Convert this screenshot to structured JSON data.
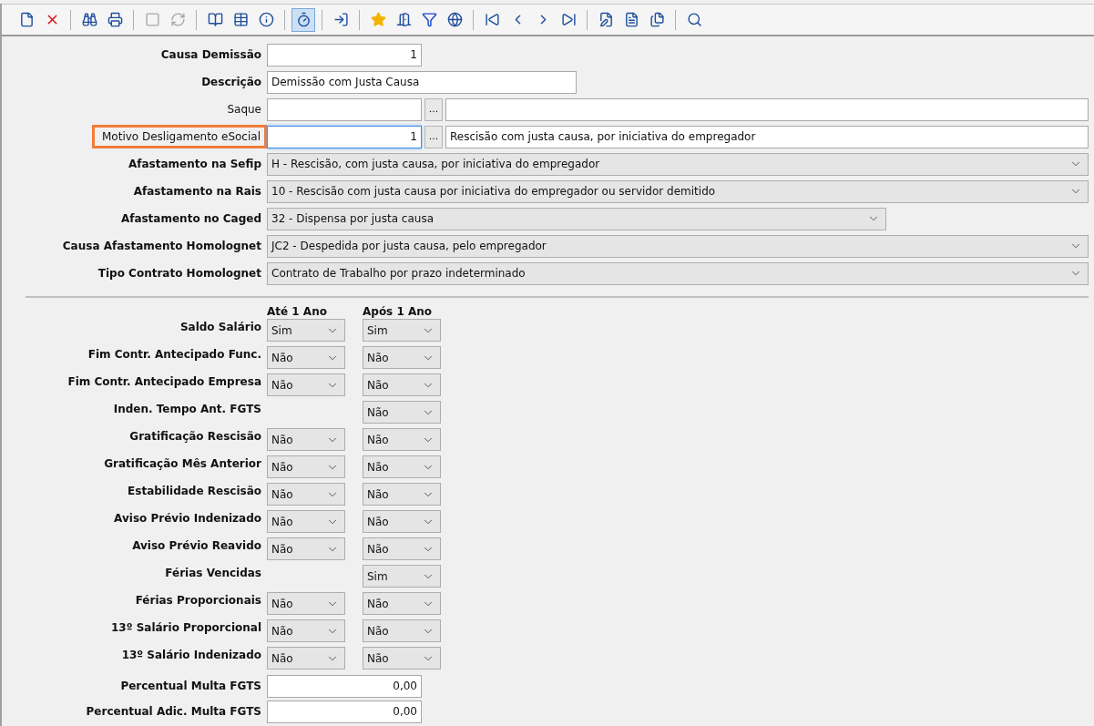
{
  "toolbar": {
    "groups": [
      [
        {
          "pressed": false,
          "disabled": false
        },
        {
          "pressed": false,
          "disabled": false
        }
      ],
      [
        {
          "pressed": false,
          "disabled": false
        },
        {
          "pressed": false,
          "disabled": false
        }
      ],
      [
        {
          "pressed": false,
          "disabled": true
        },
        {
          "pressed": false,
          "disabled": true
        }
      ],
      [
        {
          "pressed": false,
          "disabled": false
        },
        {
          "pressed": false,
          "disabled": false
        },
        {
          "pressed": false,
          "disabled": false
        }
      ],
      [
        {
          "pressed": true,
          "disabled": false
        }
      ],
      [
        {
          "pressed": false,
          "disabled": false
        }
      ],
      [
        {
          "pressed": false,
          "disabled": false
        },
        {
          "pressed": false,
          "disabled": false
        },
        {
          "pressed": false,
          "disabled": false
        },
        {
          "pressed": false,
          "disabled": false
        }
      ],
      [
        {
          "pressed": false,
          "disabled": false
        },
        {
          "pressed": false,
          "disabled": false
        },
        {
          "pressed": false,
          "disabled": false
        },
        {
          "pressed": false,
          "disabled": false
        }
      ],
      [
        {
          "pressed": false,
          "disabled": false
        },
        {
          "pressed": false,
          "disabled": false
        },
        {
          "pressed": false,
          "disabled": false
        }
      ],
      [
        {
          "pressed": false,
          "disabled": false
        }
      ]
    ]
  },
  "fields": [
    {
      "kind": "number",
      "label": "Causa Demissão",
      "bold": true,
      "value": "1"
    },
    {
      "kind": "text",
      "label": "Descrição",
      "bold": true,
      "value": "Demissão com Justa Causa"
    },
    {
      "kind": "lookup",
      "label": "Saque",
      "bold": false,
      "highlighted": false,
      "focused": false,
      "button": "..."
    },
    {
      "kind": "lookup",
      "label": "Motivo Desligamento eSocial",
      "bold": false,
      "highlighted": true,
      "focused": true,
      "value": "1",
      "button": "...",
      "description": "Rescisão com justa causa, por iniciativa do empregador"
    },
    {
      "kind": "select",
      "label": "Afastamento na Sefip",
      "bold": true,
      "wide": true,
      "value": "H - Rescisão, com justa causa, por iniciativa do empregador"
    },
    {
      "kind": "select",
      "label": "Afastamento na Rais",
      "bold": true,
      "wide": true,
      "value": "10 - Rescisão com justa causa por iniciativa do empregador ou servidor demitido"
    },
    {
      "kind": "select",
      "label": "Afastamento no Caged",
      "bold": true,
      "wide": false,
      "value": "32 - Dispensa por justa causa"
    },
    {
      "kind": "select",
      "label": "Causa Afastamento Homolognet",
      "bold": true,
      "wide": true,
      "value": "JC2 - Despedida por justa causa, pelo empregador"
    },
    {
      "kind": "select",
      "label": "Tipo Contrato Homolognet",
      "bold": true,
      "wide": true,
      "value": "Contrato de Trabalho por prazo indeterminado"
    }
  ],
  "rescission": {
    "columns": [
      "Até 1 Ano",
      "Após 1 Ano"
    ],
    "rows": [
      {
        "label": "Saldo Salário",
        "until_1_year": "Sim",
        "after_1_year": "Sim"
      },
      {
        "label": "Fim Contr. Antecipado Func.",
        "until_1_year": "Não",
        "after_1_year": "Não"
      },
      {
        "label": "Fim Contr. Antecipado Empresa",
        "until_1_year": "Não",
        "after_1_year": "Não"
      },
      {
        "label": "Inden. Tempo Ant. FGTS",
        "after_1_year": "Não"
      },
      {
        "label": "Gratificação Rescisão",
        "until_1_year": "Não",
        "after_1_year": "Não"
      },
      {
        "label": "Gratificação Mês Anterior",
        "until_1_year": "Não",
        "after_1_year": "Não"
      },
      {
        "label": "Estabilidade Rescisão",
        "until_1_year": "Não",
        "after_1_year": "Não"
      },
      {
        "label": "Aviso Prévio Indenizado",
        "until_1_year": "Não",
        "after_1_year": "Não"
      },
      {
        "label": "Aviso Prévio Reavido",
        "until_1_year": "Não",
        "after_1_year": "Não"
      },
      {
        "label": "Férias Vencidas",
        "after_1_year": "Sim"
      },
      {
        "label": "Férias Proporcionais",
        "until_1_year": "Não",
        "after_1_year": "Não"
      },
      {
        "label": "13º Salário Proporcional",
        "until_1_year": "Não",
        "after_1_year": "Não"
      },
      {
        "label": "13º Salário Indenizado",
        "until_1_year": "Não",
        "after_1_year": "Não"
      }
    ]
  },
  "percent_fields": [
    {
      "label": "Percentual Multa FGTS",
      "value": "0,00"
    },
    {
      "label": "Percentual Adic. Multa FGTS",
      "value": "0,00"
    }
  ]
}
